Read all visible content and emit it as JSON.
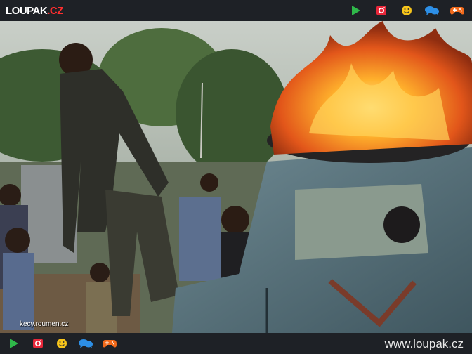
{
  "header": {
    "logo_main": "LOUPAK",
    "logo_tld": ".CZ",
    "icons": [
      "play-icon",
      "instagram-icon",
      "smiley-icon",
      "chat-icon",
      "gamepad-icon"
    ]
  },
  "photo": {
    "watermark": "kecy.roumen.cz"
  },
  "footer": {
    "site_url": "www.loupak.cz",
    "icons": [
      "play-icon",
      "instagram-icon",
      "smiley-icon",
      "chat-icon",
      "gamepad-icon"
    ]
  },
  "colors": {
    "bar_bg": "#1e2126",
    "play": "#2fb84a",
    "instagram": "#e8273a",
    "smiley": "#f7c51b",
    "chat": "#2d8fe6",
    "gamepad": "#f26a1b",
    "logo_accent": "#ff2e2e"
  }
}
